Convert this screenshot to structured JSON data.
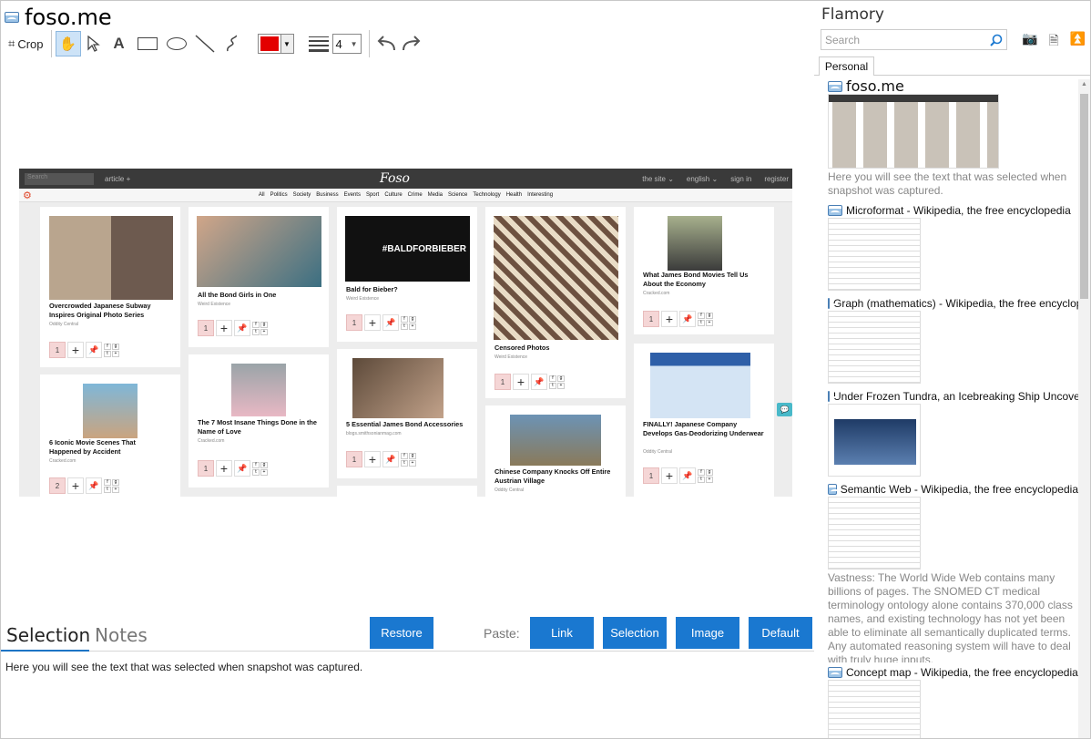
{
  "window": {
    "title": "foso.me"
  },
  "toolbar": {
    "crop_label": "Crop",
    "text_glyph": "A",
    "width_value": "4"
  },
  "snapshot": {
    "search_placeholder": "Search",
    "article_menu": "article +",
    "logo": "Foso",
    "nav_right": [
      "the site ⌄",
      "english ⌄",
      "sign in",
      "register"
    ],
    "categories": [
      "All",
      "Politics",
      "Society",
      "Business",
      "Events",
      "Sport",
      "Culture",
      "Crime",
      "Media",
      "Science",
      "Technology",
      "Health",
      "Interesting"
    ],
    "cards": [
      {
        "title": "Overcrowded Japanese Subway Inspires Original Photo Series",
        "source": "Oddity Central",
        "count": "1"
      },
      {
        "title": "All the Bond Girls in One",
        "source": "Weird Existence",
        "count": "1"
      },
      {
        "title": "Bald for Bieber?",
        "source": "Weird Existence",
        "count": "1",
        "image_text": "#BALDFORBIEBER"
      },
      {
        "title": "Censored Photos",
        "source": "Weird Existence",
        "count": "1"
      },
      {
        "title": "What James Bond Movies Tell Us About the Economy",
        "source": "Cracked.com",
        "count": "1"
      },
      {
        "title": "6 Iconic Movie Scenes That Happened by Accident",
        "source": "Cracked.com",
        "count": "2"
      },
      {
        "title": "The 7 Most Insane Things Done in the Name of Love",
        "source": "Cracked.com",
        "count": "1"
      },
      {
        "title": "5 Essential James Bond Accessories",
        "source": "blogs.smithsonianmag.com",
        "count": "1"
      },
      {
        "title": "Chinese Company Knocks Off Entire Austrian Village",
        "source": "Oddity Central",
        "count": ""
      },
      {
        "title": "FINALLY! Japanese Company Develops Gas-Deodorizing Underwear",
        "source": "Oddity Central",
        "count": "1"
      }
    ]
  },
  "bottom": {
    "tabs": [
      "Selection",
      "Notes"
    ],
    "restore_label": "Restore",
    "paste_label": "Paste:",
    "paste_buttons": [
      "Link",
      "Selection",
      "Image",
      "Default"
    ],
    "description": "Here you will see the text that was selected when snapshot was captured."
  },
  "sidebar": {
    "app_title": "Flamory",
    "search_placeholder": "Search",
    "tab_label": "Personal",
    "items": [
      {
        "title": "foso.me",
        "text": "Here you will see the text that was selected when\nsnapshot was captured."
      },
      {
        "title": "Microformat - Wikipedia, the free encyclopedia",
        "text": ""
      },
      {
        "title": "Graph (mathematics) - Wikipedia, the free encyclopedia",
        "text": ""
      },
      {
        "title": "Under Frozen Tundra, an Icebreaking Ship Uncovers",
        "text": ""
      },
      {
        "title": "Semantic Web - Wikipedia, the free encyclopedia",
        "text": "Vastness: The World Wide Web contains many\nbillions of pages. The SNOMED CT medical\nterminology ontology alone contains 370,000 class\nnames, and existing technology has not yet been\nable to eliminate all semantically duplicated terms.\nAny automated reasoning system will have to deal\nwith truly huge inputs."
      },
      {
        "title": "Concept map - Wikipedia, the free encyclopedia",
        "text": ""
      }
    ]
  },
  "colors": {
    "accent": "#1a78d0",
    "pen_color": "#e30000",
    "count_bg": "#f5d6d6"
  }
}
